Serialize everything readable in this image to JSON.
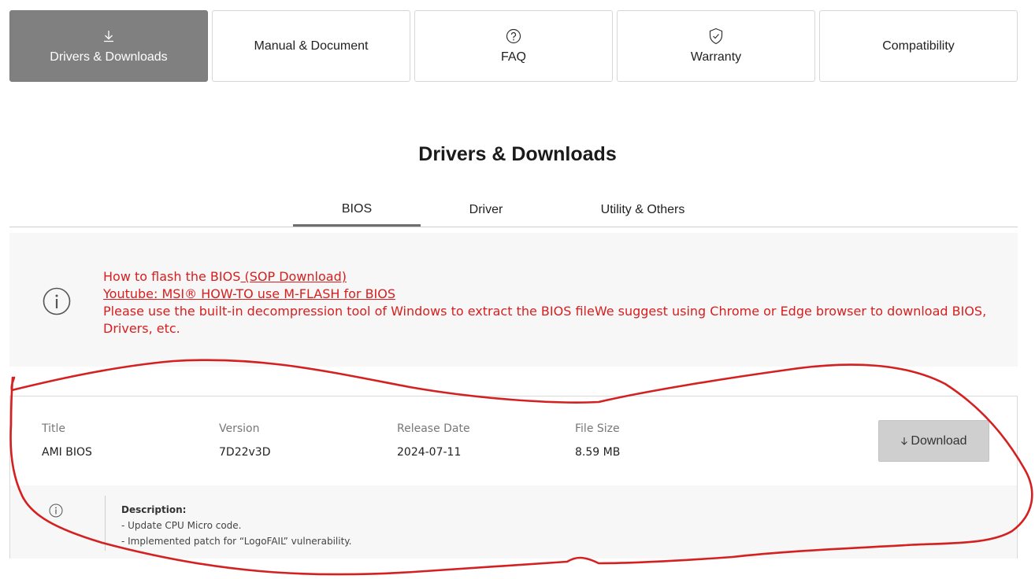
{
  "top_tabs": {
    "drivers": "Drivers & Downloads",
    "manual": "Manual & Document",
    "faq": "FAQ",
    "warranty": "Warranty",
    "compatibility": "Compatibility"
  },
  "section_title": "Drivers & Downloads",
  "sub_tabs": {
    "bios": "BIOS",
    "driver": "Driver",
    "utility": "Utility & Others"
  },
  "notice": {
    "line1_text": "How to flash the BIOS",
    "line1_link": " (SOP Download)",
    "line2_link": "Youtube: MSI® HOW-TO use M-FLASH for BIOS",
    "line3": "Please use the built-in decompression tool of Windows to extract the BIOS fileWe suggest using Chrome or Edge browser to download BIOS, Drivers, etc."
  },
  "download": {
    "headers": {
      "title": "Title",
      "version": "Version",
      "release_date": "Release Date",
      "file_size": "File Size"
    },
    "values": {
      "title": "AMI BIOS",
      "version": "7D22v3D",
      "release_date": "2024-07-11",
      "file_size": "8.59 MB"
    },
    "button_label": "Download",
    "description_title": "Description:",
    "description_lines": [
      "- Update CPU Micro code.",
      "- Implemented patch for “LogoFAIL” vulnerability."
    ]
  },
  "colors": {
    "accent_red": "#d81e1e",
    "active_tab": "#808080",
    "annotation": "#d42020"
  },
  "icons": [
    "download-icon",
    "question-circle-icon",
    "shield-check-icon",
    "info-circle-icon"
  ]
}
